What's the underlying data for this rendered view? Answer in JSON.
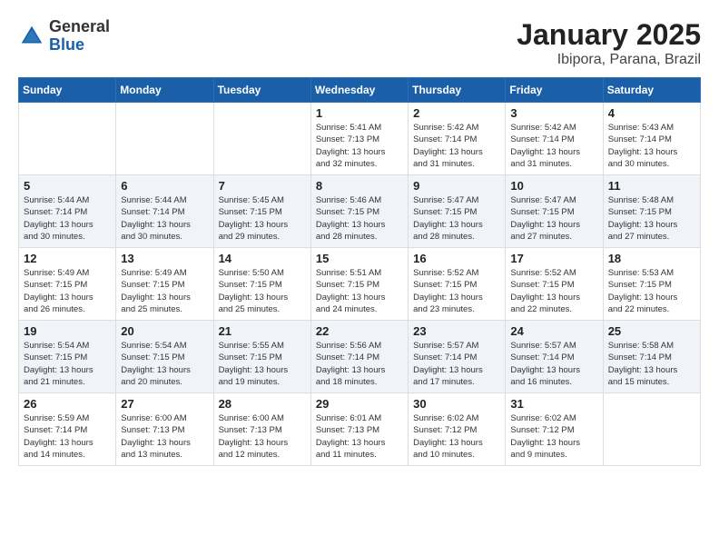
{
  "logo": {
    "general": "General",
    "blue": "Blue"
  },
  "header": {
    "month": "January 2025",
    "location": "Ibipora, Parana, Brazil"
  },
  "weekdays": [
    "Sunday",
    "Monday",
    "Tuesday",
    "Wednesday",
    "Thursday",
    "Friday",
    "Saturday"
  ],
  "weeks": [
    [
      {
        "day": "",
        "info": ""
      },
      {
        "day": "",
        "info": ""
      },
      {
        "day": "",
        "info": ""
      },
      {
        "day": "1",
        "info": "Sunrise: 5:41 AM\nSunset: 7:13 PM\nDaylight: 13 hours\nand 32 minutes."
      },
      {
        "day": "2",
        "info": "Sunrise: 5:42 AM\nSunset: 7:14 PM\nDaylight: 13 hours\nand 31 minutes."
      },
      {
        "day": "3",
        "info": "Sunrise: 5:42 AM\nSunset: 7:14 PM\nDaylight: 13 hours\nand 31 minutes."
      },
      {
        "day": "4",
        "info": "Sunrise: 5:43 AM\nSunset: 7:14 PM\nDaylight: 13 hours\nand 30 minutes."
      }
    ],
    [
      {
        "day": "5",
        "info": "Sunrise: 5:44 AM\nSunset: 7:14 PM\nDaylight: 13 hours\nand 30 minutes."
      },
      {
        "day": "6",
        "info": "Sunrise: 5:44 AM\nSunset: 7:14 PM\nDaylight: 13 hours\nand 30 minutes."
      },
      {
        "day": "7",
        "info": "Sunrise: 5:45 AM\nSunset: 7:15 PM\nDaylight: 13 hours\nand 29 minutes."
      },
      {
        "day": "8",
        "info": "Sunrise: 5:46 AM\nSunset: 7:15 PM\nDaylight: 13 hours\nand 28 minutes."
      },
      {
        "day": "9",
        "info": "Sunrise: 5:47 AM\nSunset: 7:15 PM\nDaylight: 13 hours\nand 28 minutes."
      },
      {
        "day": "10",
        "info": "Sunrise: 5:47 AM\nSunset: 7:15 PM\nDaylight: 13 hours\nand 27 minutes."
      },
      {
        "day": "11",
        "info": "Sunrise: 5:48 AM\nSunset: 7:15 PM\nDaylight: 13 hours\nand 27 minutes."
      }
    ],
    [
      {
        "day": "12",
        "info": "Sunrise: 5:49 AM\nSunset: 7:15 PM\nDaylight: 13 hours\nand 26 minutes."
      },
      {
        "day": "13",
        "info": "Sunrise: 5:49 AM\nSunset: 7:15 PM\nDaylight: 13 hours\nand 25 minutes."
      },
      {
        "day": "14",
        "info": "Sunrise: 5:50 AM\nSunset: 7:15 PM\nDaylight: 13 hours\nand 25 minutes."
      },
      {
        "day": "15",
        "info": "Sunrise: 5:51 AM\nSunset: 7:15 PM\nDaylight: 13 hours\nand 24 minutes."
      },
      {
        "day": "16",
        "info": "Sunrise: 5:52 AM\nSunset: 7:15 PM\nDaylight: 13 hours\nand 23 minutes."
      },
      {
        "day": "17",
        "info": "Sunrise: 5:52 AM\nSunset: 7:15 PM\nDaylight: 13 hours\nand 22 minutes."
      },
      {
        "day": "18",
        "info": "Sunrise: 5:53 AM\nSunset: 7:15 PM\nDaylight: 13 hours\nand 22 minutes."
      }
    ],
    [
      {
        "day": "19",
        "info": "Sunrise: 5:54 AM\nSunset: 7:15 PM\nDaylight: 13 hours\nand 21 minutes."
      },
      {
        "day": "20",
        "info": "Sunrise: 5:54 AM\nSunset: 7:15 PM\nDaylight: 13 hours\nand 20 minutes."
      },
      {
        "day": "21",
        "info": "Sunrise: 5:55 AM\nSunset: 7:15 PM\nDaylight: 13 hours\nand 19 minutes."
      },
      {
        "day": "22",
        "info": "Sunrise: 5:56 AM\nSunset: 7:14 PM\nDaylight: 13 hours\nand 18 minutes."
      },
      {
        "day": "23",
        "info": "Sunrise: 5:57 AM\nSunset: 7:14 PM\nDaylight: 13 hours\nand 17 minutes."
      },
      {
        "day": "24",
        "info": "Sunrise: 5:57 AM\nSunset: 7:14 PM\nDaylight: 13 hours\nand 16 minutes."
      },
      {
        "day": "25",
        "info": "Sunrise: 5:58 AM\nSunset: 7:14 PM\nDaylight: 13 hours\nand 15 minutes."
      }
    ],
    [
      {
        "day": "26",
        "info": "Sunrise: 5:59 AM\nSunset: 7:14 PM\nDaylight: 13 hours\nand 14 minutes."
      },
      {
        "day": "27",
        "info": "Sunrise: 6:00 AM\nSunset: 7:13 PM\nDaylight: 13 hours\nand 13 minutes."
      },
      {
        "day": "28",
        "info": "Sunrise: 6:00 AM\nSunset: 7:13 PM\nDaylight: 13 hours\nand 12 minutes."
      },
      {
        "day": "29",
        "info": "Sunrise: 6:01 AM\nSunset: 7:13 PM\nDaylight: 13 hours\nand 11 minutes."
      },
      {
        "day": "30",
        "info": "Sunrise: 6:02 AM\nSunset: 7:12 PM\nDaylight: 13 hours\nand 10 minutes."
      },
      {
        "day": "31",
        "info": "Sunrise: 6:02 AM\nSunset: 7:12 PM\nDaylight: 13 hours\nand 9 minutes."
      },
      {
        "day": "",
        "info": ""
      }
    ]
  ]
}
